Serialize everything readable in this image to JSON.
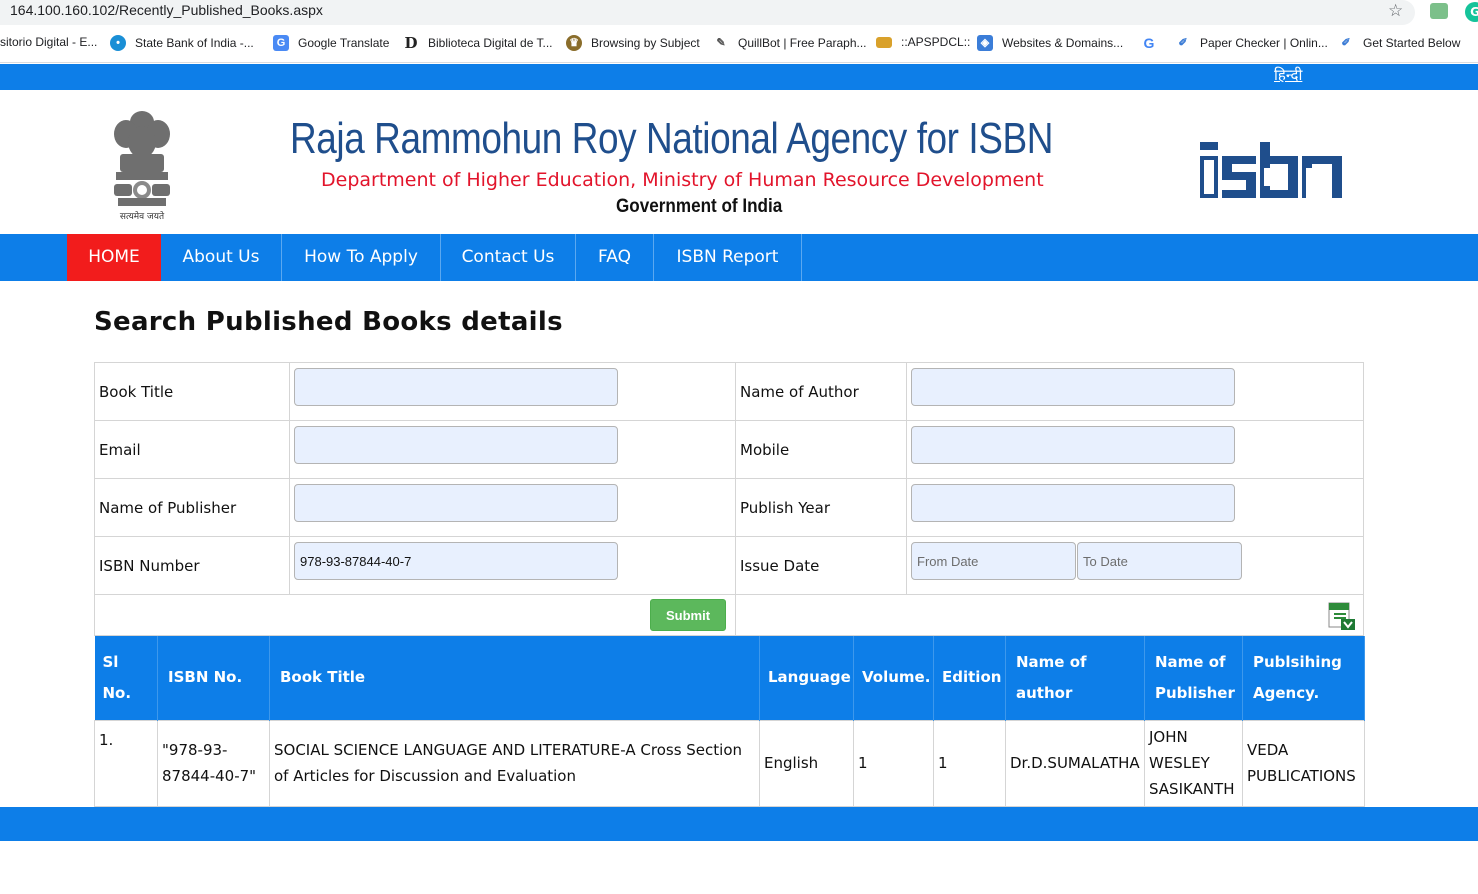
{
  "browser": {
    "url": "164.100.160.102/Recently_Published_Books.aspx",
    "bookmarks": [
      {
        "label": "sitorio Digital - E...",
        "icon": "none"
      },
      {
        "label": "State Bank of India -...",
        "icon": "sbi-icon"
      },
      {
        "label": "Google Translate",
        "icon": "translate-icon"
      },
      {
        "label": "Biblioteca Digital de T...",
        "icon": "d-letter-icon"
      },
      {
        "label": "Browsing by Subject",
        "icon": "crest-icon"
      },
      {
        "label": "QuillBot | Free Paraph...",
        "icon": "quill-icon"
      },
      {
        "label": "::APSPDCL::",
        "icon": "card-icon"
      },
      {
        "label": "Websites & Domains...",
        "icon": "web-icon"
      },
      {
        "label": "",
        "icon": "google-g-icon"
      },
      {
        "label": "Paper Checker | Onlin...",
        "icon": "pen-icon"
      },
      {
        "label": "Get Started Below",
        "icon": "pen-icon"
      }
    ]
  },
  "site": {
    "hindi_link": "हिन्दी",
    "title": "Raja Rammohun Roy National Agency for ISBN",
    "subtitle": "Department of Higher Education, Ministry of Human Resource Development",
    "government": "Government of India",
    "emblem_caption": "सत्यमेव जयते",
    "logo_text": "isbn",
    "colors": {
      "primary": "#0d7ee8",
      "active_nav": "#f21c1c",
      "title": "#1f4e8c",
      "subtitle": "#e2142b",
      "submit": "#5cb85c"
    }
  },
  "nav": [
    {
      "label": "HOME",
      "active": true
    },
    {
      "label": "About Us"
    },
    {
      "label": "How To Apply"
    },
    {
      "label": "Contact Us"
    },
    {
      "label": "FAQ"
    },
    {
      "label": "ISBN Report"
    }
  ],
  "search": {
    "heading": "Search Published Books details",
    "book_title_label": "Book Title",
    "author_label": "Name of Author",
    "email_label": "Email",
    "mobile_label": "Mobile",
    "publisher_label": "Name of Publisher",
    "publish_year_label": "Publish Year",
    "isbn_label": "ISBN Number",
    "isbn_value": "978-93-87844-40-7",
    "issue_date_label": "Issue Date",
    "from_date_placeholder": "From Date",
    "to_date_placeholder": "To Date",
    "submit_label": "Submit"
  },
  "results": {
    "headers": [
      "Sl No.",
      "ISBN No.",
      "Book Title",
      "Language",
      "Volume.",
      "Edition",
      "Name of author",
      "Name of Publisher",
      "Publsihing Agency."
    ],
    "rows": [
      {
        "sl": "1.",
        "isbn": "\"978-93-87844-40-7\"",
        "title": "SOCIAL SCIENCE LANGUAGE AND LITERATURE-A Cross Section of Articles for Discussion and Evaluation",
        "language": "English",
        "volume": "1",
        "edition": "1",
        "author": "Dr.D.SUMALATHA",
        "publisher": "JOHN WESLEY SASIKANTH",
        "agency": "VEDA PUBLICATIONS"
      }
    ]
  }
}
